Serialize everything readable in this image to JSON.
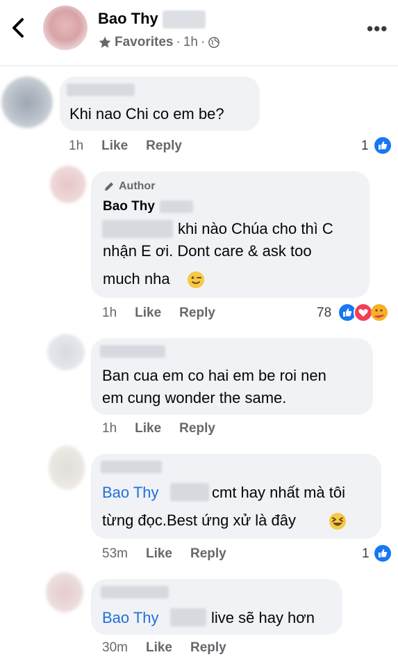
{
  "header": {
    "page_name": "Bao Thy",
    "audience": "Favorites",
    "time": "1h",
    "separator": "·",
    "more": "•••"
  },
  "comments": [
    {
      "text": "Khi nao Chi co em be?",
      "time": "1h",
      "like": "Like",
      "reply": "Reply",
      "reactions": "1"
    },
    {
      "author_badge": "Author",
      "name": "Bao Thy",
      "line1": "khi nào Chúa cho thì C",
      "line2": "nhận E ơi. Dont care & ask too",
      "line3": "much nha",
      "time": "1h",
      "like": "Like",
      "reply": "Reply",
      "reactions": "78"
    },
    {
      "line1": "Ban cua em co hai em be roi nen",
      "line2": "em cung wonder the same.",
      "time": "1h",
      "like": "Like",
      "reply": "Reply"
    },
    {
      "mention": "Bao Thy",
      "line1_tail": "cmt hay nhất mà tôi",
      "line2": "từng đọc.Best ứng xử là đây",
      "time": "53m",
      "like": "Like",
      "reply": "Reply",
      "reactions": "1"
    },
    {
      "mention": "Bao Thy",
      "line1_tail": "live sẽ hay hơn",
      "time": "30m",
      "like": "Like",
      "reply": "Reply"
    }
  ],
  "colors": {
    "link": "#216fdb",
    "meta": "#65676b",
    "bubble": "#f0f2f5",
    "like": "#1877f2",
    "love": "#f33e58",
    "care": "#f7b125"
  }
}
